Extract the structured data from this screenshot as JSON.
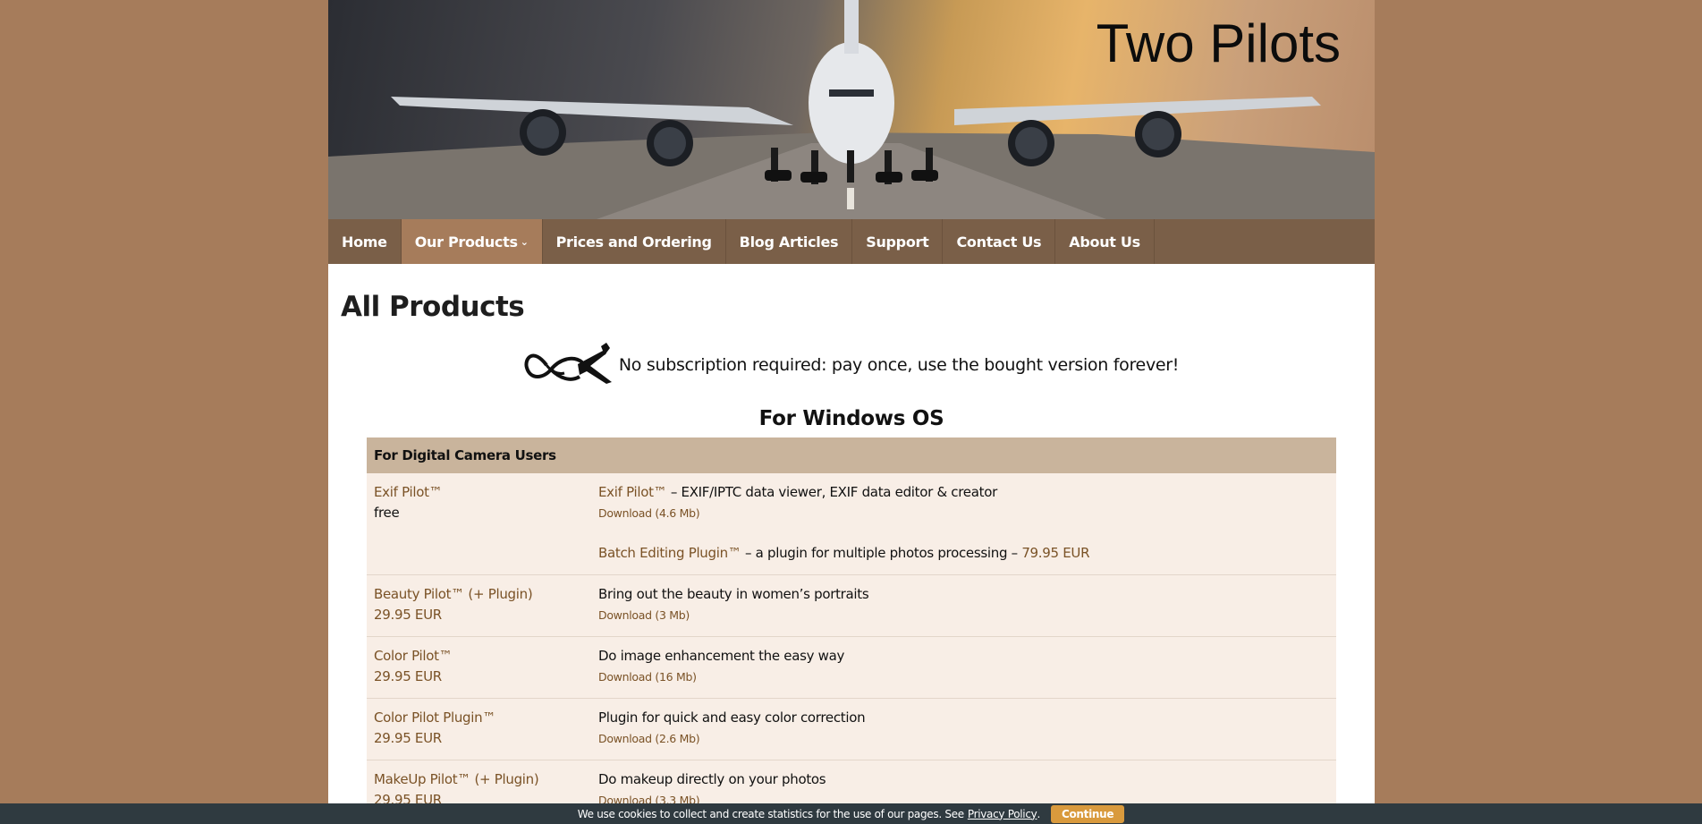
{
  "site": {
    "title": "Two Pilots"
  },
  "nav": {
    "items": [
      {
        "label": "Home"
      },
      {
        "label": "Our Products",
        "chevron": "⌄"
      },
      {
        "label": "Prices and Ordering"
      },
      {
        "label": "Blog Articles"
      },
      {
        "label": "Support"
      },
      {
        "label": "Contact Us"
      },
      {
        "label": "About Us"
      }
    ]
  },
  "page": {
    "title": "All Products",
    "promo": "No subscription required: pay once, use the bought version forever!",
    "os_heading": "For Windows OS"
  },
  "section": {
    "title": "For Digital Camera Users"
  },
  "products": [
    {
      "name": "Exif Pilot™",
      "price": "free",
      "desc_link": "Exif Pilot™",
      "desc_text": " – EXIF/IPTC data viewer, EXIF data editor & creator",
      "download": "Download (4.6 Mb)",
      "plugin_link": "Batch Editing Plugin™",
      "plugin_text": " – a plugin for multiple photos processing – ",
      "plugin_price": "79.95 EUR"
    },
    {
      "name": "Beauty Pilot™ (+ Plugin)",
      "price": "29.95 EUR",
      "desc": "Bring out the beauty in women’s portraits",
      "download": "Download (3 Mb)"
    },
    {
      "name": "Color Pilot™",
      "price": "29.95 EUR",
      "desc": "Do image enhancement the easy way",
      "download": "Download (16 Mb)"
    },
    {
      "name": "Color Pilot Plugin™",
      "price": "29.95 EUR",
      "desc": "Plugin for quick and easy color correction",
      "download": "Download (2.6 Mb)"
    },
    {
      "name": "MakeUp Pilot™ (+ Plugin)",
      "price": "29.95 EUR",
      "desc": "Do makeup directly on your photos",
      "download": "Download (3.3 Mb)"
    }
  ],
  "cookie": {
    "text": "We use cookies to collect and create statistics for the use of our pages. See",
    "link": "Privacy Policy",
    "period": ".",
    "button": "Continue"
  },
  "colors": {
    "background": "#a67c5b",
    "nav": "#7a5f48",
    "nav_active": "#a67c5b",
    "section_head": "#c9b49c",
    "row": "#f8eee6",
    "link": "#7a5226",
    "cookie_bar": "#2f3a40",
    "cookie_button": "#d99a3d"
  }
}
